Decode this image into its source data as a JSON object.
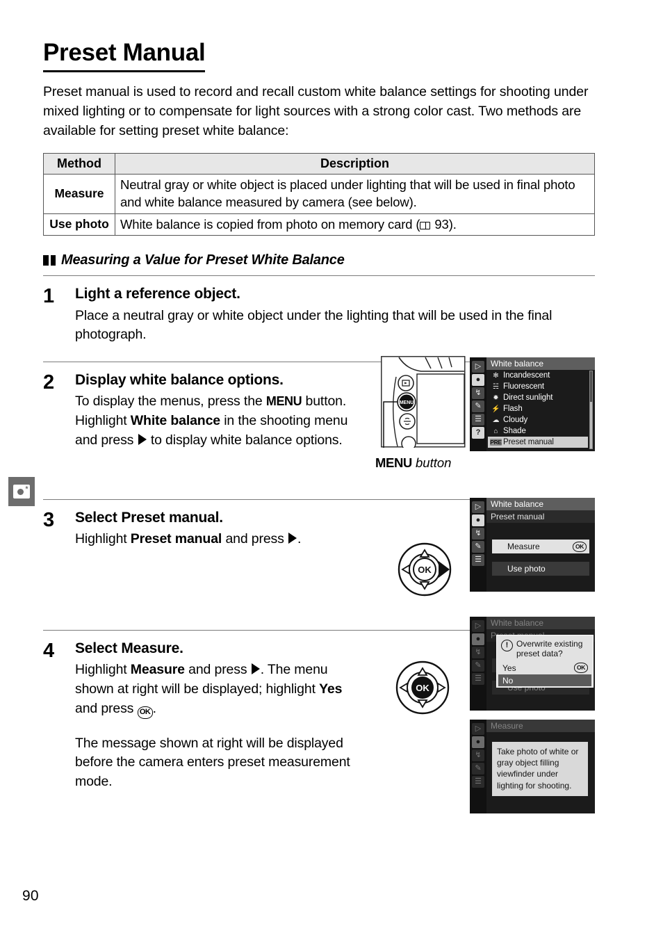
{
  "page": {
    "number": "90",
    "side_tab_icon": "shooting-menu-camera-icon"
  },
  "title": "Preset Manual",
  "intro": "Preset manual is used to record and recall custom white balance settings for shooting under mixed lighting or to compensate for light sources with a strong color cast.  Two methods are available for setting preset white balance:",
  "method_table": {
    "headers": [
      "Method",
      "Description"
    ],
    "rows": [
      {
        "method": "Measure",
        "description": "Neutral gray or white object is placed under lighting that will be used in final photo and white balance measured by camera (see below)."
      },
      {
        "method": "Use photo",
        "description_before": "White balance is copied from photo on memory card (",
        "page_ref": "93",
        "description_after": ")."
      }
    ]
  },
  "section": {
    "heading": "Measuring a Value for Preset White Balance"
  },
  "steps": [
    {
      "number": "1",
      "title": "Light a reference object.",
      "text": "Place a neutral gray or white object under the lighting that will be used in the final photograph."
    },
    {
      "number": "2",
      "title": "Display white balance options.",
      "text_1": "To display the menus, press the ",
      "menu_word": "MENU",
      "text_2": " button. Highlight ",
      "bold_1": "White balance",
      "text_3": " in the shooting menu and press ",
      "text_4": " to display white balance options.",
      "caption_bold": "MENU",
      "caption_italic": " button"
    },
    {
      "number": "3",
      "title_lite": "Select ",
      "title_bold": "Preset manual.",
      "text_1": "Highlight ",
      "bold_1": "Preset manual",
      "text_2": " and press ",
      "text_3": "."
    },
    {
      "number": "4",
      "title_lite": "Select ",
      "title_bold": "Measure.",
      "text_1": "Highlight ",
      "bold_1": "Measure",
      "text_2": " and press ",
      "text_3": ".  The menu shown at right will be displayed; highlight ",
      "bold_2": "Yes",
      "text_4": " and press ",
      "text_5": ".",
      "text_second_para": "The message shown at right will be displayed before the camera enters preset measurement mode."
    }
  ],
  "lcd_wb_menu": {
    "header": "White balance",
    "sidebar_icons": [
      "playback-icon",
      "shooting-menu-icon",
      "setup-wrench-icon",
      "retouch-pencil-icon",
      "recent-settings-icon",
      "help-question-icon"
    ],
    "items": [
      {
        "icon": "incandescent-icon",
        "icon_glyph": "✻",
        "label": "Incandescent"
      },
      {
        "icon": "fluorescent-icon",
        "icon_glyph": "☵",
        "label": "Fluorescent"
      },
      {
        "icon": "direct-sunlight-icon",
        "icon_glyph": "✹",
        "label": "Direct sunlight"
      },
      {
        "icon": "flash-icon",
        "icon_glyph": "⚡",
        "label": "Flash"
      },
      {
        "icon": "cloudy-icon",
        "icon_glyph": "☁",
        "label": "Cloudy"
      },
      {
        "icon": "shade-icon",
        "icon_glyph": "⌂",
        "label": "Shade"
      },
      {
        "icon": "preset-manual-icon",
        "icon_glyph": "PRE",
        "label": "Preset manual",
        "highlighted": true
      }
    ]
  },
  "lcd_preset_menu": {
    "header": "White balance",
    "subheader": "Preset manual",
    "options": [
      {
        "label": "Measure",
        "badge": "OK",
        "highlighted": true
      },
      {
        "label": "Use photo",
        "badge": "",
        "highlighted": false
      }
    ]
  },
  "lcd_overwrite_dialog": {
    "header": "White balance",
    "subheader": "Preset manual",
    "dialog_message": "Overwrite existing preset data?",
    "alert_glyph": "!",
    "options": [
      {
        "label": "Yes",
        "badge": "OK",
        "selected": false
      },
      {
        "label": "No",
        "badge": "",
        "selected": true
      }
    ]
  },
  "lcd_measure_message": {
    "header": "Measure",
    "message": "Take photo of white or gray object filling viewfinder under lighting for shooting."
  },
  "multi_selector": {
    "ok_label": "OK",
    "step3_state": "right-arrow-filled",
    "step4_state": "ok-filled"
  },
  "colors": {
    "page_background": "#ffffff",
    "text": "#000000",
    "table_header_fill": "#e7e7e7",
    "rule": "#7a7a7a",
    "side_tab_fill": "#6d6d6d",
    "lcd_background": "#1b1b1b",
    "lcd_header": "#5e5e5e",
    "lcd_highlight": "#d8d8d8"
  }
}
